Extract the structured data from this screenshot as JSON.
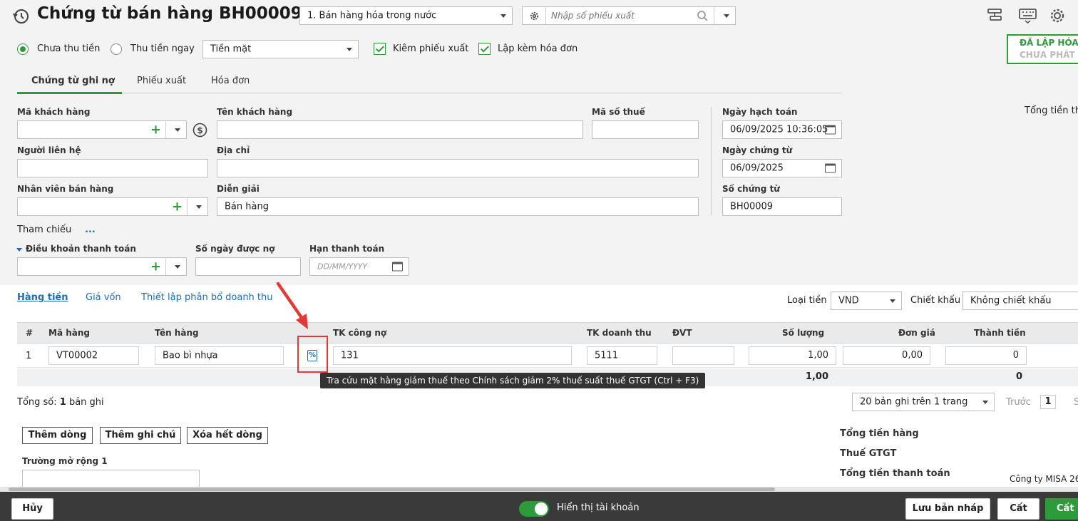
{
  "header": {
    "title": "Chứng từ bán hàng BH00009",
    "sale_type": "1. Bán hàng hóa trong nước",
    "export_search_placeholder": "Nhập số phiếu xuất"
  },
  "options": {
    "radio_unpaid": "Chưa thu tiền",
    "radio_paid": "Thu tiền ngay",
    "payment_method": "Tiền mặt",
    "check_export": "Kiêm phiếu xuất",
    "check_invoice": "Lập kèm hóa đơn"
  },
  "status": {
    "line1": "ĐÃ LẬP HÓA",
    "line2": "CHƯA PHÁT"
  },
  "tabs": [
    "Chứng từ ghi nợ",
    "Phiếu xuất",
    "Hóa đơn"
  ],
  "form": {
    "customer_code_label": "Mã khách hàng",
    "customer_name_label": "Tên khách hàng",
    "tax_code_label": "Mã số thuế",
    "contact_label": "Người liên hệ",
    "address_label": "Địa chỉ",
    "salesperson_label": "Nhân viên bán hàng",
    "description_label": "Diễn giải",
    "description_value": "Bán hàng",
    "reference_label": "Tham chiếu",
    "reference_more": "...",
    "payment_terms_label": "Điều khoản thanh toán",
    "credit_days_label": "Số ngày được nợ",
    "due_date_label": "Hạn thanh toán",
    "due_date_placeholder": "DD/MM/YYYY",
    "posting_date_label": "Ngày hạch toán",
    "posting_date_value": "06/09/2025 10:36:05",
    "voucher_date_label": "Ngày chứng từ",
    "voucher_date_value": "06/09/2025",
    "voucher_no_label": "Số chứng từ",
    "voucher_no_value": "BH00009",
    "total_label_partial": "Tổng tiền th"
  },
  "subtabs": [
    "Hàng tiền",
    "Giá vốn",
    "Thiết lập phân bổ doanh thu"
  ],
  "currency": {
    "label": "Loại tiền",
    "value": "VND"
  },
  "discount": {
    "label": "Chiết khấu",
    "value": "Không chiết khấu"
  },
  "table": {
    "headers": [
      "#",
      "Mã hàng",
      "Tên hàng",
      "TK công nợ",
      "TK doanh thu",
      "ĐVT",
      "Số lượng",
      "Đơn giá",
      "Thành tiền"
    ],
    "row": {
      "no": "1",
      "code": "VT00002",
      "name": "Bao bì nhựa",
      "debt_account": "131",
      "revenue_account": "5111",
      "unit": "",
      "quantity": "1,00",
      "unit_price": "0,00",
      "amount": "0"
    },
    "totals": {
      "quantity": "1,00",
      "amount": "0"
    },
    "tax_lookup_icon_text": "%"
  },
  "tooltip": "Tra cứu mặt hàng giảm thuế theo Chính sách giảm 2% thuế suất thuế GTGT (Ctrl + F3)",
  "records": {
    "prefix": "Tổng số:",
    "count": "1",
    "suffix": "bản ghi"
  },
  "paging": {
    "per_page": "20 bản ghi trên 1 trang",
    "prev": "Trước",
    "page": "1",
    "next_partial": "S"
  },
  "actions": {
    "add_row": "Thêm dòng",
    "add_note": "Thêm ghi chú",
    "clear_rows": "Xóa hết dòng"
  },
  "extended_field_label": "Trường mở rộng 1",
  "summary": {
    "goods_total": "Tổng tiền hàng",
    "vat": "Thuế GTGT",
    "payment_total": "Tổng tiền thanh toán"
  },
  "company_partial": "Công ty MISA 26",
  "footer": {
    "cancel": "Hủy",
    "show_accounts": "Hiển thị tài khoản",
    "save_draft": "Lưu bản nháp",
    "save": "Cất",
    "save_green": "Cất"
  },
  "colors": {
    "accent_green": "#2e9b3a",
    "link_blue": "#1e6fb8",
    "highlight_red": "#e53935",
    "footer_bg": "#3a3a3a"
  }
}
